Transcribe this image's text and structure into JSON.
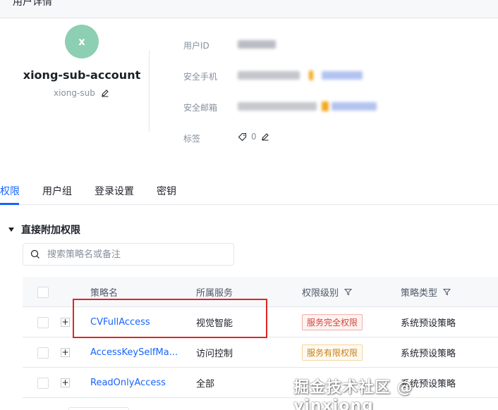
{
  "header": {
    "title": "用户详情"
  },
  "profile": {
    "avatar_letter": "x",
    "account_name": "xiong-sub-account",
    "display_name": "xiong-sub"
  },
  "info": {
    "user_id_label": "用户ID",
    "phone_label": "安全手机",
    "email_label": "安全邮箱",
    "tag_label": "标签",
    "tag_count": "0"
  },
  "tabs": [
    {
      "label": "权限"
    },
    {
      "label": "用户组"
    },
    {
      "label": "登录设置"
    },
    {
      "label": "密钥"
    }
  ],
  "section": {
    "title": "直接附加权限"
  },
  "search": {
    "placeholder": "搜索策略名或备注"
  },
  "table": {
    "headers": {
      "name": "策略名",
      "service": "所属服务",
      "level": "权限级别",
      "type": "策略类型"
    },
    "rows": [
      {
        "name": "CVFullAccess",
        "service": "视觉智能",
        "level": "服务完全权限",
        "type": "系统预设策略"
      },
      {
        "name": "AccessKeySelfMa...",
        "service": "访问控制",
        "level": "服务有限权限",
        "type": "系统预设策略"
      },
      {
        "name": "ReadOnlyAccess",
        "service": "全部",
        "level": "",
        "type": "系统预设策略"
      }
    ]
  },
  "watermark": "掘金技术社区 @ vinxiong",
  "colors": {
    "accent": "#1664ff",
    "avatar": "#8ccfb2",
    "highlight": "#e02424"
  }
}
